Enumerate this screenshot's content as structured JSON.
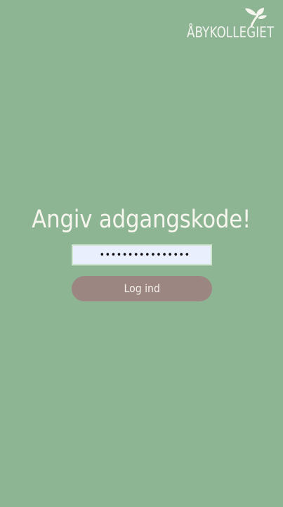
{
  "brand": {
    "logo_text": "ÅBYKOLLEGIET",
    "logo_icon": "leaf-logo-icon"
  },
  "login": {
    "heading": "Angiv adgangskode!",
    "password_value": "••••••••••••••••",
    "password_placeholder": "",
    "button_label": "Log ind"
  },
  "colors": {
    "background": "#8db594",
    "input_background": "#e9effc",
    "input_border": "#cfe4cf",
    "button_background": "#9b8681",
    "text_light": "#f7f6ee"
  }
}
